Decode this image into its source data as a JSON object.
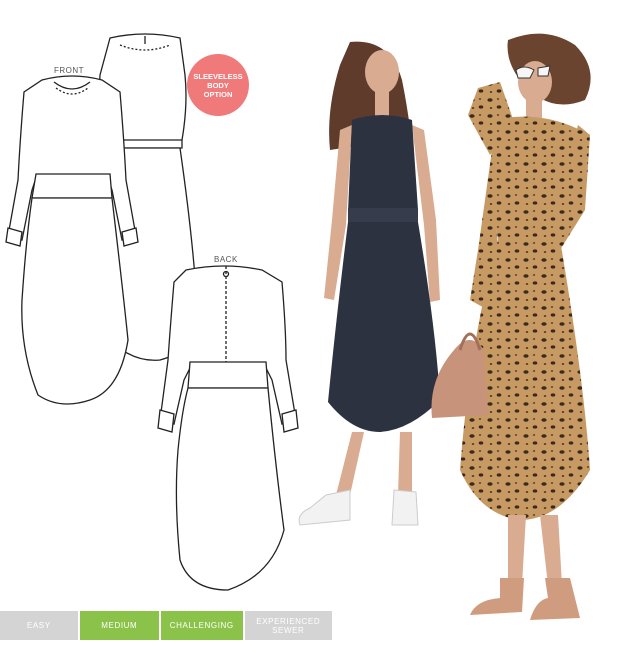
{
  "labels": {
    "front": "FRONT",
    "back": "BACK"
  },
  "badge": {
    "lines": [
      "SLEEVELESS",
      "BODY",
      "OPTION"
    ],
    "color": "#f07a7a"
  },
  "difficulty": {
    "levels": [
      {
        "label": "EASY",
        "color": "#d4d4d4",
        "selected": false
      },
      {
        "label": "MEDIUM",
        "color": "#8bc34a",
        "selected": true
      },
      {
        "label": "CHALLENGING",
        "color": "#8bc34a",
        "selected": false
      },
      {
        "label": "EXPERIENCED SEWER",
        "color": "#d4d4d4",
        "selected": false
      }
    ]
  },
  "colors": {
    "sketch_line": "#222222",
    "navy_dress": "#2c3240",
    "leopard_base": "#c89a63",
    "leopard_spot": "#3a2a1c",
    "skin": "#d9ab90",
    "hair": "#5e3b2b",
    "bag": "#c7937a",
    "heels": "#d09c80"
  }
}
